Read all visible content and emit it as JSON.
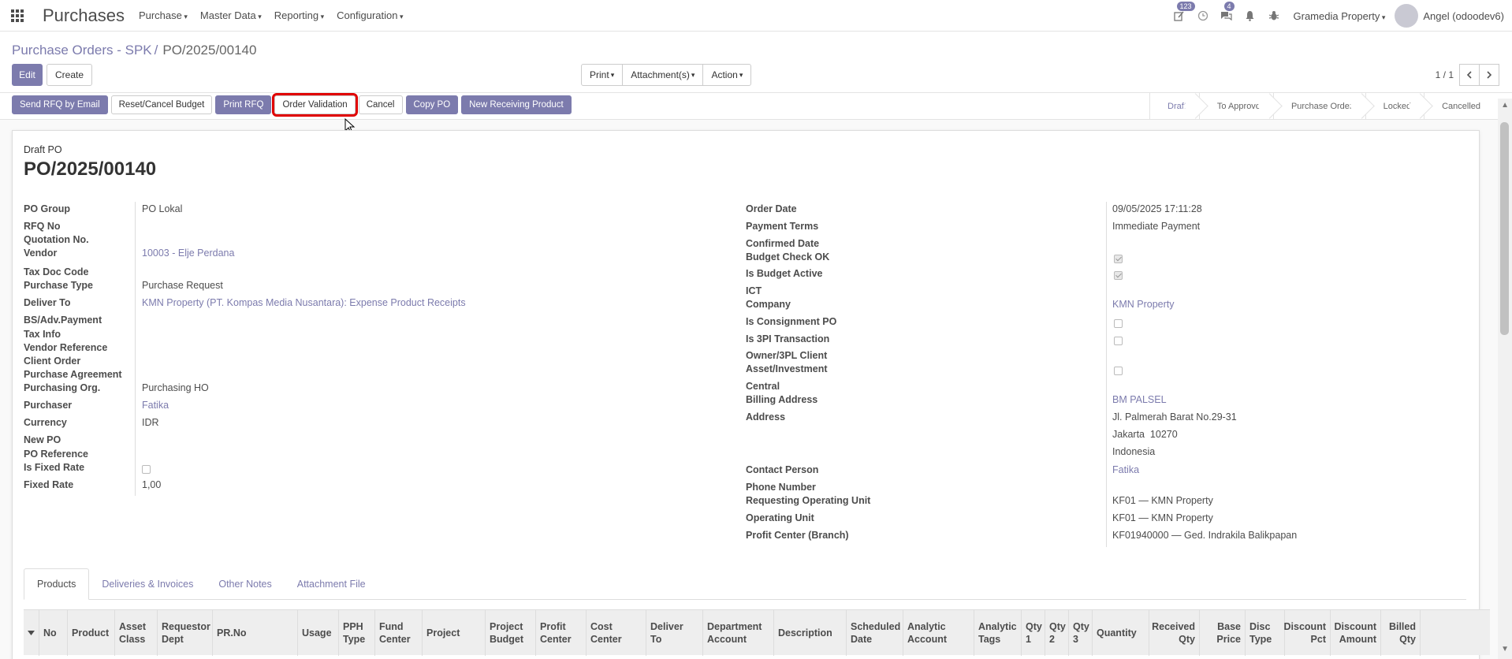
{
  "navbar": {
    "app_name": "Purchases",
    "menus": [
      "Purchase",
      "Master Data",
      "Reporting",
      "Configuration"
    ],
    "activity_count": "123",
    "message_count": "4",
    "company": "Gramedia Property",
    "user": "Angel (odoodev6)"
  },
  "breadcrumb": {
    "parent": "Purchase Orders - SPK",
    "separator": "/",
    "current": "PO/2025/00140"
  },
  "buttons": {
    "edit": "Edit",
    "create": "Create",
    "print": "Print",
    "attachments": "Attachment(s)",
    "action": "Action"
  },
  "pager": {
    "value": "1 / 1"
  },
  "actions": {
    "send_rfq": "Send RFQ by Email",
    "reset_cancel_budget": "Reset/Cancel Budget",
    "print_rfq": "Print RFQ",
    "order_validation": "Order Validation",
    "cancel": "Cancel",
    "copy_po": "Copy PO",
    "new_receiving": "New Receiving Product"
  },
  "stages": [
    "Draft",
    "To Approve",
    "Purchase Order",
    "Locked",
    "Cancelled"
  ],
  "active_stage": "Draft",
  "form": {
    "draft_label": "Draft PO",
    "title": "PO/2025/00140",
    "left": {
      "po_group": {
        "label": "PO Group",
        "value": "PO Lokal"
      },
      "rfq_no": {
        "label": "RFQ No",
        "value": ""
      },
      "quotation_no": {
        "label": "Quotation No.",
        "value": ""
      },
      "vendor": {
        "label": "Vendor",
        "value": "10003 - Elje Perdana"
      },
      "tax_doc_code": {
        "label": "Tax Doc Code",
        "value": ""
      },
      "purchase_type": {
        "label": "Purchase Type",
        "value": "Purchase Request"
      },
      "deliver_to": {
        "label": "Deliver To",
        "value": "KMN Property (PT. Kompas Media Nusantara): Expense Product Receipts"
      },
      "bs_adv_payment": {
        "label": "BS/Adv.Payment",
        "value": ""
      },
      "tax_info": {
        "label": "Tax Info",
        "value": ""
      },
      "vendor_reference": {
        "label": "Vendor Reference",
        "value": ""
      },
      "client_order": {
        "label": "Client Order",
        "value": ""
      },
      "purchase_agreement": {
        "label": "Purchase Agreement",
        "value": ""
      },
      "purchasing_org": {
        "label": "Purchasing Org.",
        "value": "Purchasing HO"
      },
      "purchaser": {
        "label": "Purchaser",
        "value": "Fatika"
      },
      "currency": {
        "label": "Currency",
        "value": "IDR"
      },
      "new_po": {
        "label": "New PO",
        "value": ""
      },
      "po_reference": {
        "label": "PO Reference",
        "value": ""
      },
      "is_fixed_rate": {
        "label": "Is Fixed Rate",
        "checked": false
      },
      "fixed_rate": {
        "label": "Fixed Rate",
        "value": "1,00"
      }
    },
    "right": {
      "order_date": {
        "label": "Order Date",
        "value": "09/05/2025 17:11:28"
      },
      "payment_terms": {
        "label": "Payment Terms",
        "value": "Immediate Payment"
      },
      "confirmed_date": {
        "label": "Confirmed Date",
        "value": ""
      },
      "budget_check_ok": {
        "label": "Budget Check OK",
        "checked": true
      },
      "is_budget_active": {
        "label": "Is Budget Active",
        "checked": true
      },
      "ict": {
        "label": "ICT",
        "value": ""
      },
      "company": {
        "label": "Company",
        "value": "KMN Property"
      },
      "is_consignment_po": {
        "label": "Is Consignment PO",
        "checked": false
      },
      "is_3pl_transaction": {
        "label": "Is 3PI Transaction",
        "checked": false
      },
      "owner_3pl_client": {
        "label": "Owner/3PL Client",
        "value": ""
      },
      "asset_investment": {
        "label": "Asset/Investment",
        "checked": false
      },
      "central": {
        "label": "Central",
        "value": ""
      },
      "billing_address": {
        "label": "Billing Address",
        "value": "BM PALSEL"
      },
      "address": {
        "label": "Address",
        "line1": "Jl. Palmerah Barat No.29-31",
        "line2": "Jakarta  10270",
        "line3": "Indonesia"
      },
      "contact_person": {
        "label": "Contact Person",
        "value": "Fatika"
      },
      "phone_number": {
        "label": "Phone Number",
        "value": ""
      },
      "requesting_operating_unit": {
        "label": "Requesting Operating Unit",
        "value": "KF01 — KMN Property"
      },
      "operating_unit": {
        "label": "Operating Unit",
        "value": "KF01 — KMN Property"
      },
      "profit_center": {
        "label": "Profit Center (Branch)",
        "value": "KF01940000 — Ged. Indrakila Balikpapan"
      }
    }
  },
  "tabs": [
    "Products",
    "Deliveries & Invoices",
    "Other Notes",
    "Attachment File"
  ],
  "active_tab": "Products",
  "table": {
    "columns": [
      {
        "l1": "No",
        "l2": ""
      },
      {
        "l1": "Product",
        "l2": ""
      },
      {
        "l1": "Asset",
        "l2": "Class"
      },
      {
        "l1": "Requestor",
        "l2": "Dept"
      },
      {
        "l1": "PR.No",
        "l2": ""
      },
      {
        "l1": "Usage",
        "l2": ""
      },
      {
        "l1": "PPH",
        "l2": "Type"
      },
      {
        "l1": "Fund",
        "l2": "Center"
      },
      {
        "l1": "Project",
        "l2": ""
      },
      {
        "l1": "Project",
        "l2": "Budget"
      },
      {
        "l1": "Profit",
        "l2": "Center"
      },
      {
        "l1": "Cost",
        "l2": "Center"
      },
      {
        "l1": "Deliver",
        "l2": "To"
      },
      {
        "l1": "Department",
        "l2": "Account"
      },
      {
        "l1": "Description",
        "l2": ""
      },
      {
        "l1": "Scheduled",
        "l2": "Date"
      },
      {
        "l1": "Analytic",
        "l2": "Account"
      },
      {
        "l1": "Analytic",
        "l2": "Tags"
      },
      {
        "l1": "Qty",
        "l2": "1"
      },
      {
        "l1": "Qty",
        "l2": "2"
      },
      {
        "l1": "Qty",
        "l2": "3"
      },
      {
        "l1": "Quantity",
        "l2": ""
      },
      {
        "l1": "Received",
        "l2": "Qty"
      },
      {
        "l1": "Base",
        "l2": "Price"
      },
      {
        "l1": "Disc",
        "l2": "Type"
      },
      {
        "l1": "Discount",
        "l2": "Pct"
      },
      {
        "l1": "Discount",
        "l2": "Amount"
      },
      {
        "l1": "Billed",
        "l2": "Qty"
      }
    ]
  },
  "colors": {
    "primary": "#7c7bad",
    "highlight": "#e00000"
  }
}
